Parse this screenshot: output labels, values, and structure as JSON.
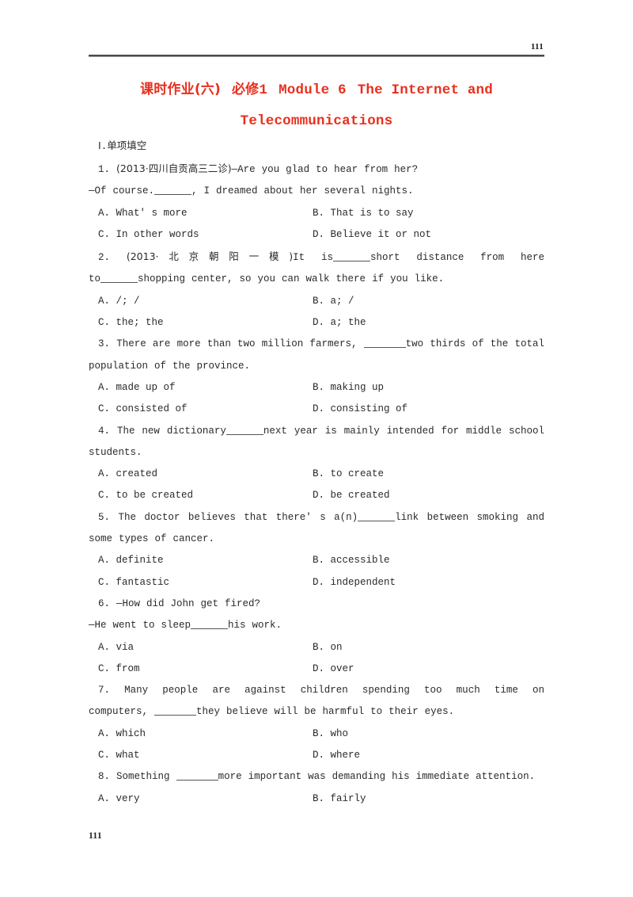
{
  "header": {
    "folio": "111"
  },
  "title": {
    "line1_cn": "课时作业(六)",
    "line1_part2": "必修",
    "line1_num": "1",
    "line1_module": "Module 6",
    "line1_tail": "The Internet and",
    "line2": "Telecommunications"
  },
  "section": {
    "label_num": "Ⅰ",
    "label_dot": ".",
    "label_cn": "单项填空"
  },
  "questions": [
    {
      "num": "1.",
      "source": "(2013·四川自贡高三二诊)",
      "stem_lines": [
        "—Are you glad to hear from her?",
        "—Of course.",
        ", I dreamed about her several nights."
      ],
      "options": {
        "A": "A. What' s more",
        "B": "B. That is to say",
        "C": "C. In other words",
        "D": "D. Believe it or not"
      }
    },
    {
      "num": "2.",
      "source": "(2013·北京朝阳一模)",
      "stem_lines": [
        "It is",
        "short distance from here",
        "to",
        "shopping center, so you can walk there if you like."
      ],
      "options": {
        "A": "A. /; /",
        "B": "B. a; /",
        "C": "C. the; the",
        "D": "D. a; the"
      }
    },
    {
      "num": "3.",
      "source": "",
      "stem_lines": [
        "There are more than two million farmers,",
        "two thirds of the total",
        "population of the province."
      ],
      "options": {
        "A": "A. made up of",
        "B": "B. making up",
        "C": "C. consisted of",
        "D": "D. consisting of"
      }
    },
    {
      "num": "4.",
      "source": "",
      "stem_lines": [
        "The new dictionary",
        "next year is mainly intended for middle school",
        "students."
      ],
      "options": {
        "A": "A. created",
        "B": "B. to create",
        "C": "C. to be created",
        "D": "D. be created"
      }
    },
    {
      "num": "5.",
      "source": "",
      "stem_lines": [
        "The doctor believes that there' s a(n)",
        "link between smoking and",
        "some types of cancer."
      ],
      "options": {
        "A": "A. definite",
        "B": "B. accessible",
        "C": "C. fantastic",
        "D": "D. independent"
      }
    },
    {
      "num": "6.",
      "source": "",
      "stem_lines": [
        "—How did John get fired?",
        "—He went to sleep",
        "his work."
      ],
      "options": {
        "A": "A. via",
        "B": "B. on",
        "C": "C. from",
        "D": "D. over"
      }
    },
    {
      "num": "7.",
      "source": "",
      "stem_lines": [
        "Many people are against children spending too much time on",
        "computers,",
        "they believe will be harmful to their eyes."
      ],
      "options": {
        "A": "A. which",
        "B": "B. who",
        "C": "C. what",
        "D": "D. where"
      }
    },
    {
      "num": "8.",
      "source": "",
      "stem_lines": [
        "Something",
        "more important was demanding his immediate attention."
      ],
      "options": {
        "A": "A. very",
        "B": "B. fairly"
      }
    }
  ],
  "footer": {
    "folio": "111"
  },
  "colors": {
    "title_red": "#e8301e",
    "body_text": "#2a2a2a",
    "rule_dark": "#4a4a4a",
    "rule_light": "#9a9a9a"
  }
}
